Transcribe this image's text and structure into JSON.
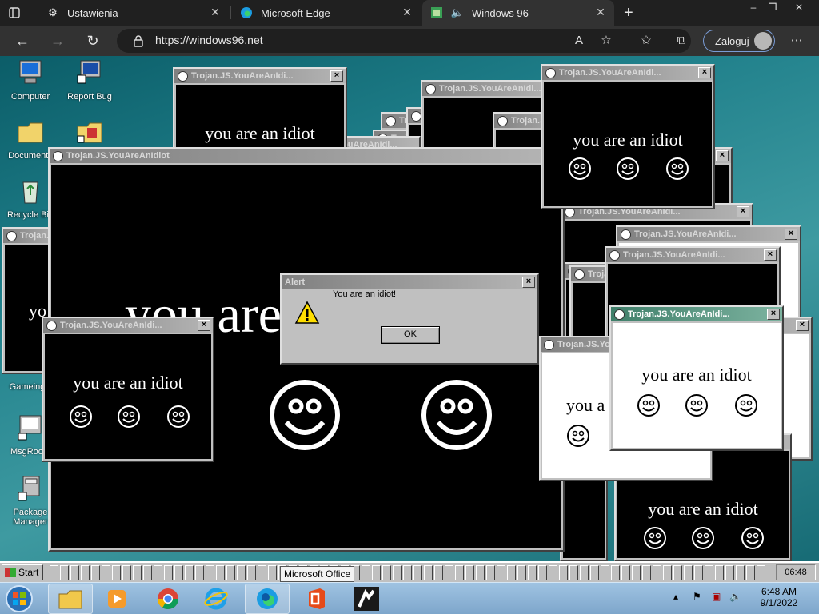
{
  "browser": {
    "tabs": [
      {
        "label": "Ustawienia",
        "icon": "gear-icon"
      },
      {
        "label": "Microsoft Edge",
        "icon": "edge-icon"
      },
      {
        "label": "Windows 96",
        "icon": "windows96-icon"
      }
    ],
    "url": "https://windows96.net",
    "login_label": "Zaloguj"
  },
  "desktop": {
    "icons": [
      {
        "label": "Computer"
      },
      {
        "label": "Report Bug"
      },
      {
        "label": "Documents"
      },
      {
        "label": "Recycle Bin"
      },
      {
        "label": "Gameing"
      },
      {
        "label": "MsgRoom"
      },
      {
        "label": "Package Manager"
      }
    ]
  },
  "popup": {
    "title": "Trojan.JS.YouAreAnIdiot",
    "title_short": "Trojan.JS.YouAreAnIdi...",
    "message": "you are an idiot",
    "partial_big": "you are",
    "partial_small": "you a",
    "partial_tiny": "yo",
    "partial_idiot": "idiot",
    "close_glyph": "×"
  },
  "alert": {
    "title": "Alert",
    "message": "You are an idiot!",
    "ok_label": "OK"
  },
  "taskbar96": {
    "start_label": "Start",
    "tooltip": "Microsoft Office",
    "clock": "06:48"
  },
  "taskbar7": {
    "time": "6:48 AM",
    "date": "9/1/2022"
  },
  "colors": {
    "popup_bg": "#000000",
    "titlebar_inactive": "#808080",
    "titlebar_active": "#3f7f6a"
  }
}
